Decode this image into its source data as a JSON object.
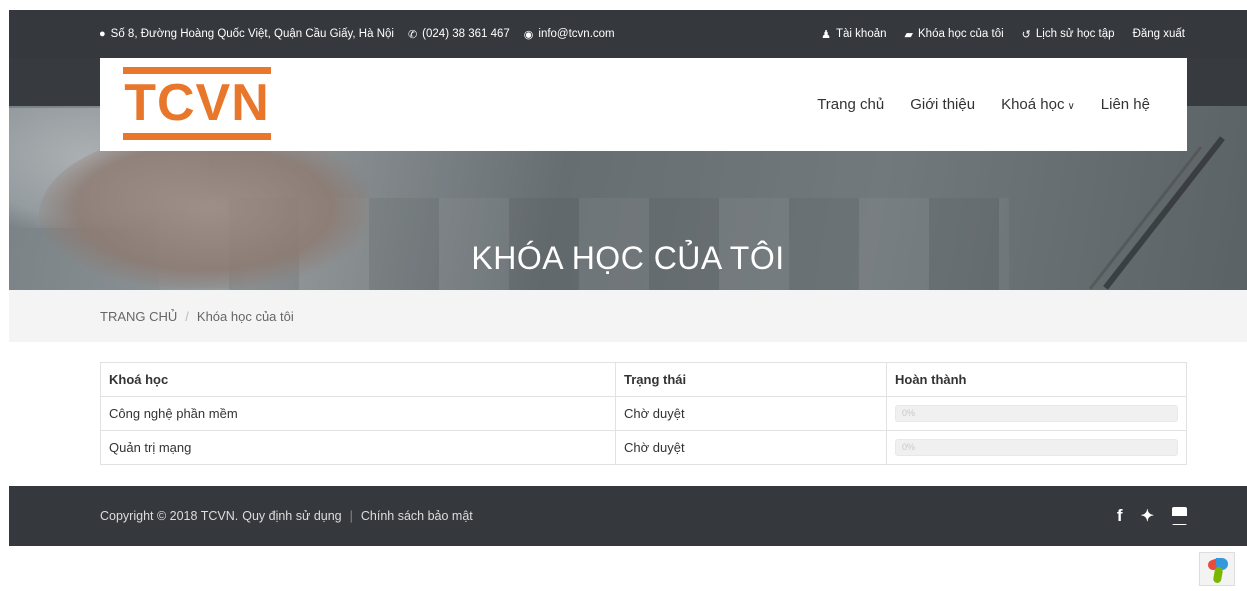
{
  "topbar": {
    "address": "Số 8, Đường Hoàng Quốc Việt, Quận Cầu Giấy, Hà Nội",
    "phone": "(024) 38 361 467",
    "email": "info@tcvn.com",
    "links": [
      {
        "icon": "user-icon",
        "glyph": "♟",
        "label": "Tài khoản"
      },
      {
        "icon": "book-icon",
        "glyph": "▰",
        "label": "Khóa học của tôi"
      },
      {
        "icon": "history-icon",
        "glyph": "↺",
        "label": "Lịch sử học tập"
      },
      {
        "icon": "",
        "glyph": "",
        "label": "Đăng xuất"
      }
    ]
  },
  "logo": {
    "text": "TCVN"
  },
  "nav": {
    "items": [
      "Trang chủ",
      "Giới thiệu",
      "Khoá học",
      "Liên hệ"
    ]
  },
  "hero": {
    "title": "KHÓA HỌC CỦA TÔI"
  },
  "breadcrumb": {
    "home": "TRANG CHỦ",
    "current": "Khóa học của tôi"
  },
  "table": {
    "headers": [
      "Khoá học",
      "Trạng thái",
      "Hoàn thành"
    ],
    "rows": [
      {
        "course": "Công nghệ phần mềm",
        "status": "Chờ duyệt",
        "progress": 0,
        "progress_label": "0%"
      },
      {
        "course": "Quản trị mạng",
        "status": "Chờ duyệt",
        "progress": 0,
        "progress_label": "0%"
      }
    ]
  },
  "footer": {
    "copyright": "Copyright © 2018 TCVN.",
    "terms": "Quy định sử dụng",
    "privacy": "Chính sách bảo mật",
    "social": [
      "facebook-icon",
      "twitter-icon",
      "youtube-icon"
    ]
  },
  "colors": {
    "accent": "#e8762b",
    "dark": "#35383c"
  }
}
